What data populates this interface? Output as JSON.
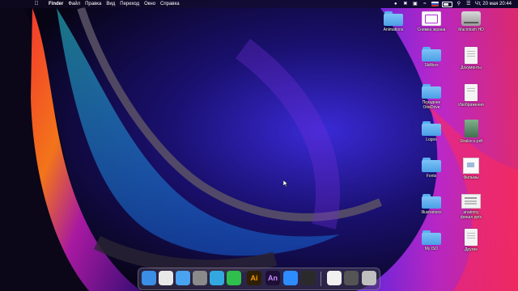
{
  "menubar": {
    "apple_icon": "apple-icon",
    "app_name": "Finder",
    "menus": [
      "Файл",
      "Правка",
      "Вид",
      "Переход",
      "Окно",
      "Справка"
    ],
    "status_icons": [
      "record-icon",
      "dropbox-icon",
      "display-icon",
      "wifi-icon",
      "flag-icon",
      "battery-icon",
      "search-icon",
      "control-center-icon"
    ],
    "clock": "Чт, 20 мая  20:44"
  },
  "desktop_icons": [
    {
      "label": "Animations",
      "kind": "folder"
    },
    {
      "label": "Снимка экрана",
      "kind": "screenshot"
    },
    {
      "label": "Macintosh HD",
      "kind": "hdd"
    },
    {
      "label": "Skillbox",
      "kind": "folder"
    },
    {
      "label": "Документы",
      "kind": "doc"
    },
    {
      "label": "Позаднее\nOneDrive",
      "kind": "folder"
    },
    {
      "label": "Изображения",
      "kind": "doc"
    },
    {
      "label": "Logos",
      "kind": "folder"
    },
    {
      "label": "Stralioco.pdf",
      "kind": "pdf"
    },
    {
      "label": "Fonts",
      "kind": "folder"
    },
    {
      "label": "Фильмы",
      "kind": "film"
    },
    {
      "label": "Illustrations",
      "kind": "folder"
    },
    {
      "label": "anatomy\nфинал.pptx",
      "kind": "pptx"
    },
    {
      "label": "My ISO",
      "kind": "folder"
    },
    {
      "label": "Другие",
      "kind": "doc"
    }
  ],
  "dock": {
    "apps": [
      {
        "name": "finder-icon",
        "text": "",
        "color": "#3a8ee6"
      },
      {
        "name": "chrome-icon",
        "text": "",
        "color": "#e8e8e8"
      },
      {
        "name": "mail-icon",
        "text": "",
        "color": "#4aa3f0"
      },
      {
        "name": "system-preferences-icon",
        "text": "",
        "color": "#8a8a8a"
      },
      {
        "name": "telegram-icon",
        "text": "",
        "color": "#33a8e0"
      },
      {
        "name": "whatsapp-icon",
        "text": "",
        "color": "#2fbf4d"
      },
      {
        "name": "illustrator-icon",
        "text": "Ai",
        "color": "#2e1f05"
      },
      {
        "name": "animate-icon",
        "text": "An",
        "color": "#1d0f36"
      },
      {
        "name": "zoom-icon",
        "text": "",
        "color": "#2d8cff"
      },
      {
        "name": "obs-icon",
        "text": "",
        "color": "#2a2a2a"
      },
      {
        "name": "document-icon",
        "text": "",
        "color": "#f0f0f0"
      },
      {
        "name": "screenshot-stack-icon",
        "text": "",
        "color": "#555555"
      },
      {
        "name": "trash-icon",
        "text": "",
        "color": "#bfbfbf"
      }
    ]
  }
}
